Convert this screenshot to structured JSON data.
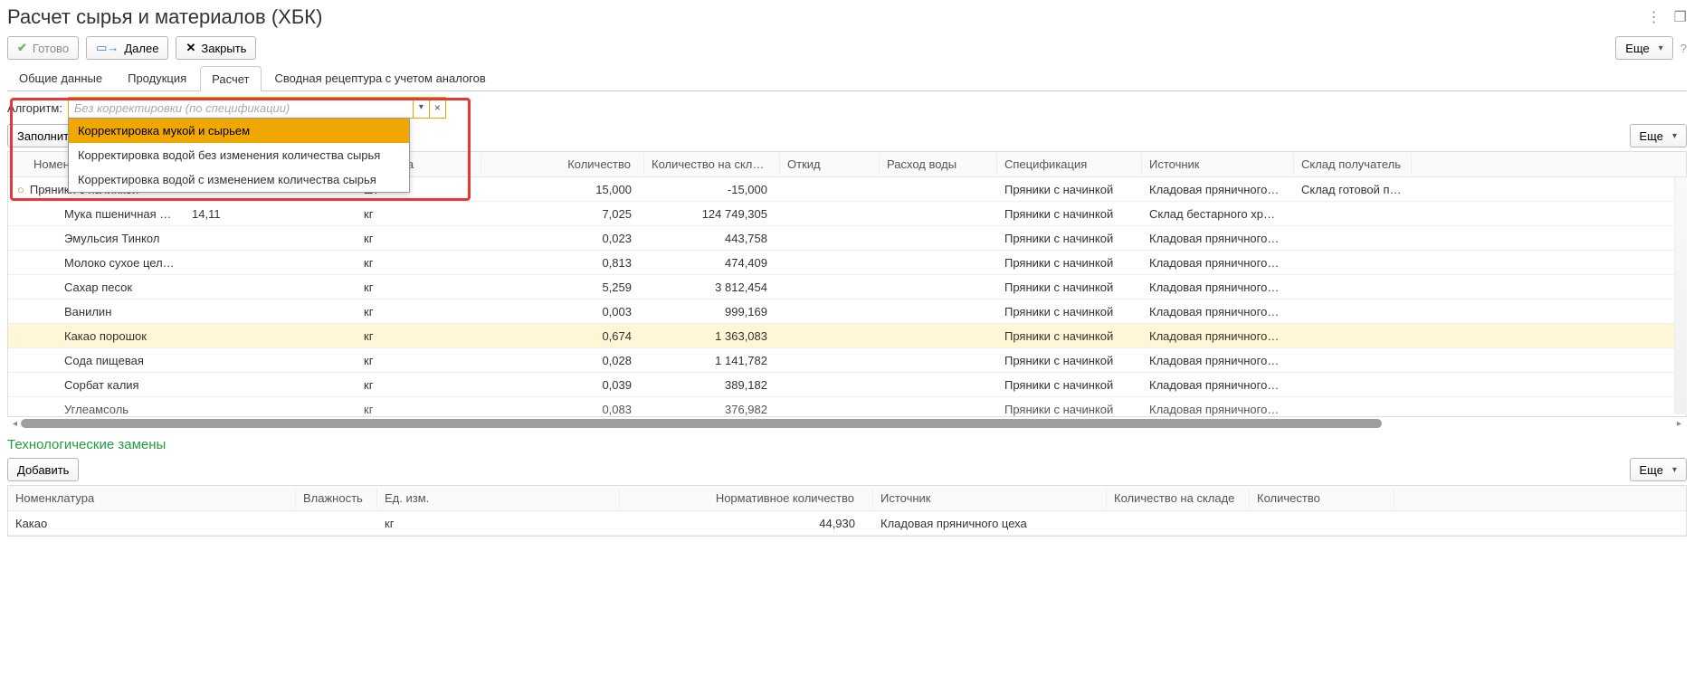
{
  "title": "Расчет сырья и материалов (ХБК)",
  "buttons": {
    "ready": "Готово",
    "next": "Далее",
    "close": "Закрыть",
    "more": "Еще",
    "fill": "Заполнить",
    "add": "Добавить"
  },
  "tabs": [
    "Общие данные",
    "Продукция",
    "Расчет",
    "Сводная рецептура с учетом аналогов"
  ],
  "active_tab": 2,
  "algo": {
    "label": "Алгоритм:",
    "placeholder": "Без корректировки (по спецификации)",
    "options": [
      "Корректировка мукой и сырьем",
      "Корректировка водой без изменения количества сырья",
      "Корректировка водой с изменением количества сырья"
    ],
    "selected": 0
  },
  "table1": {
    "headers": [
      "Номенклатура",
      "Влажность",
      "Упаковка",
      "Количество",
      "Количество на складе",
      "Откид",
      "Расход воды",
      "Спецификация",
      "Источник",
      "Склад получатель"
    ],
    "rows": [
      {
        "parent": true,
        "nom": "Пряники с начинкой",
        "hum": "",
        "unit": "шт",
        "qty": "15,000",
        "stock": "-15,000",
        "spec": "Пряники с начинкой",
        "src": "Кладовая пряничного…",
        "wh": "Склад готовой про…"
      },
      {
        "parent": false,
        "nom": "Мука пшеничная …",
        "hum": "14,11",
        "unit": "кг",
        "qty": "7,025",
        "stock": "124 749,305",
        "spec": "Пряники с начинкой",
        "src": "Склад бестарного хр…",
        "wh": ""
      },
      {
        "parent": false,
        "nom": "Эмульсия Тинкол",
        "hum": "",
        "unit": "кг",
        "qty": "0,023",
        "stock": "443,758",
        "spec": "Пряники с начинкой",
        "src": "Кладовая пряничного…",
        "wh": ""
      },
      {
        "parent": false,
        "nom": "Молоко сухое цел…",
        "hum": "",
        "unit": "кг",
        "qty": "0,813",
        "stock": "474,409",
        "spec": "Пряники с начинкой",
        "src": "Кладовая пряничного…",
        "wh": ""
      },
      {
        "parent": false,
        "nom": "Сахар песок",
        "hum": "",
        "unit": "кг",
        "qty": "5,259",
        "stock": "3 812,454",
        "spec": "Пряники с начинкой",
        "src": "Кладовая пряничного…",
        "wh": ""
      },
      {
        "parent": false,
        "nom": "Ванилин",
        "hum": "",
        "unit": "кг",
        "qty": "0,003",
        "stock": "999,169",
        "spec": "Пряники с начинкой",
        "src": "Кладовая пряничного…",
        "wh": ""
      },
      {
        "parent": false,
        "hilite": true,
        "nom": "Какао порошок",
        "hum": "",
        "unit": "кг",
        "qty": "0,674",
        "stock": "1 363,083",
        "spec": "Пряники с начинкой",
        "src": "Кладовая пряничного…",
        "wh": ""
      },
      {
        "parent": false,
        "nom": "Сода пищевая",
        "hum": "",
        "unit": "кг",
        "qty": "0,028",
        "stock": "1 141,782",
        "spec": "Пряники с начинкой",
        "src": "Кладовая пряничного…",
        "wh": ""
      },
      {
        "parent": false,
        "nom": "Сорбат калия",
        "hum": "",
        "unit": "кг",
        "qty": "0,039",
        "stock": "389,182",
        "spec": "Пряники с начинкой",
        "src": "Кладовая пряничного…",
        "wh": ""
      },
      {
        "parent": false,
        "cutoff": true,
        "nom": "Углеамсоль",
        "hum": "",
        "unit": "кг",
        "qty": "0,083",
        "stock": "376,982",
        "spec": "Пряники с начинкой",
        "src": "Кладовая пряничного…",
        "wh": ""
      }
    ]
  },
  "section2_title": "Технологические замены",
  "table2": {
    "headers": [
      "Номенклатура",
      "Влажность",
      "Ед. изм.",
      "Нормативное количество",
      "Источник",
      "Количество на складе",
      "Количество"
    ],
    "rows": [
      {
        "nom": "Какао",
        "hum": "",
        "unit": "кг",
        "norm": "44,930",
        "src": "Кладовая пряничного цеха",
        "stock": "",
        "qty": ""
      }
    ]
  }
}
